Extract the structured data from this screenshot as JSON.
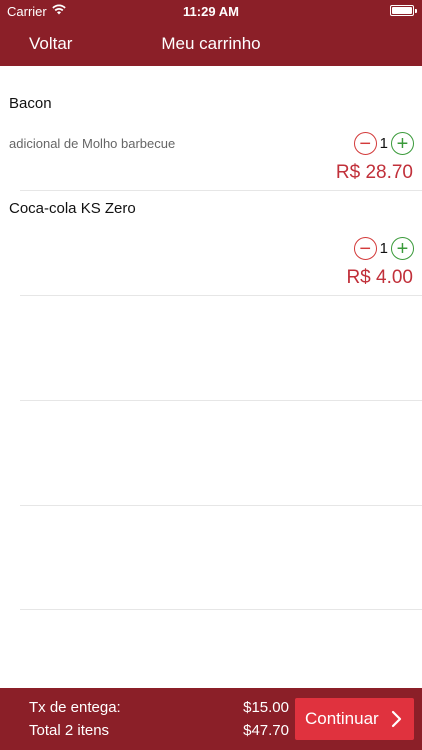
{
  "status_bar": {
    "carrier": "Carrier",
    "time": "11:29 AM"
  },
  "nav": {
    "back_label": "Voltar",
    "title": "Meu carrinho"
  },
  "cart": {
    "items": [
      {
        "name": "Bacon",
        "note": "adicional de Molho barbecue",
        "quantity": "1",
        "price": "R$ 28.70"
      },
      {
        "name": "Coca-cola KS Zero",
        "note": "",
        "quantity": "1",
        "price": "R$ 4.00"
      }
    ]
  },
  "footer": {
    "tax_label": "Tx de entega:",
    "tax_value": "$15.00",
    "total_label": "Total  2 itens",
    "total_value": "$47.70",
    "continue_label": "Continuar"
  },
  "colors": {
    "bar": "#8b1f28",
    "accent": "#e0323e",
    "price": "#c1303a",
    "minus": "#d33a3a",
    "plus": "#3a9a3a"
  },
  "icons": [
    "wifi-icon",
    "battery-icon",
    "minus-icon",
    "plus-icon",
    "chevron-right-icon"
  ]
}
